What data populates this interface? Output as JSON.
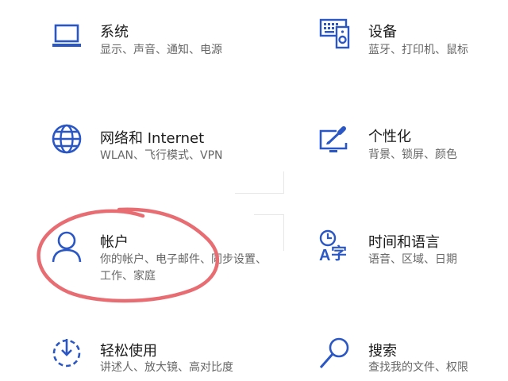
{
  "settings": {
    "system": {
      "title": "系统",
      "description": "显示、声音、通知、电源",
      "icon": "laptop-icon"
    },
    "devices": {
      "title": "设备",
      "description": "蓝牙、打印机、鼠标",
      "icon": "keyboard-speaker-icon"
    },
    "network": {
      "title": "网络和 Internet",
      "description": "WLAN、飞行模式、VPN",
      "icon": "globe-icon"
    },
    "personalization": {
      "title": "个性化",
      "description": "背景、锁屏、颜色",
      "icon": "monitor-brush-icon"
    },
    "accounts": {
      "title": "帐户",
      "description": "你的帐户、电子邮件、同步设置、工作、家庭",
      "icon": "person-icon"
    },
    "time_language": {
      "title": "时间和语言",
      "description": "语音、区域、日期",
      "icon": "clock-language-icon"
    },
    "ease_of_access": {
      "title": "轻松使用",
      "description": "讲述人、放大镜、高对比度",
      "icon": "ease-of-access-icon"
    },
    "search": {
      "title": "搜索",
      "description": "查找我的文件、权限",
      "icon": "magnifier-icon"
    }
  },
  "colors": {
    "icon_blue": "#2b57c5",
    "annotation_red": "#e86d73"
  }
}
